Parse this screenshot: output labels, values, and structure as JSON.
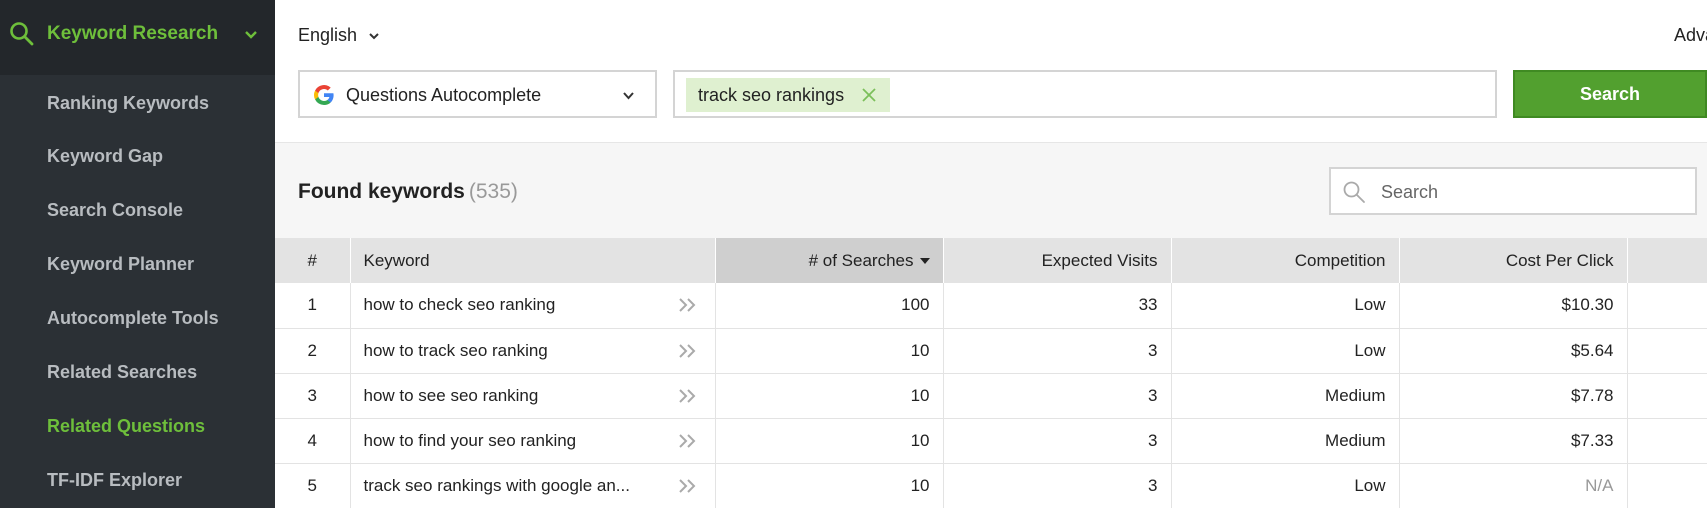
{
  "sidebar": {
    "header": "Keyword Research",
    "items": [
      {
        "label": "Ranking Keywords"
      },
      {
        "label": "Keyword Gap"
      },
      {
        "label": "Search Console"
      },
      {
        "label": "Keyword Planner"
      },
      {
        "label": "Autocomplete Tools"
      },
      {
        "label": "Related Searches"
      },
      {
        "label": "Related Questions",
        "active": true
      },
      {
        "label": "TF-IDF Explorer"
      }
    ],
    "active_color": "#6ebf3b"
  },
  "top": {
    "language": "English",
    "advanced_label": "Adva",
    "source": "Questions Autocomplete",
    "keyword_tag": "track seo rankings",
    "search_button": "Search"
  },
  "results": {
    "title": "Found keywords",
    "count": "(535)",
    "filter_placeholder": "Search",
    "columns": [
      "#",
      "Keyword",
      "# of Searches",
      "Expected Visits",
      "Competition",
      "Cost Per Click",
      ""
    ],
    "rows": [
      {
        "n": "1",
        "keyword": "how to check seo ranking",
        "searches": "100",
        "visits": "33",
        "competition": "Low",
        "cpc": "$10.30"
      },
      {
        "n": "2",
        "keyword": "how to track seo ranking",
        "searches": "10",
        "visits": "3",
        "competition": "Low",
        "cpc": "$5.64"
      },
      {
        "n": "3",
        "keyword": "how to see seo ranking",
        "searches": "10",
        "visits": "3",
        "competition": "Medium",
        "cpc": "$7.78"
      },
      {
        "n": "4",
        "keyword": "how to find your seo ranking",
        "searches": "10",
        "visits": "3",
        "competition": "Medium",
        "cpc": "$7.33"
      },
      {
        "n": "5",
        "keyword": "track seo rankings with google an...",
        "searches": "10",
        "visits": "3",
        "competition": "Low",
        "cpc": "N/A"
      }
    ]
  },
  "colors": {
    "sidebar_bg": "#2b3035",
    "accent_green": "#52a02f",
    "tag_bg": "#dff0d0"
  }
}
